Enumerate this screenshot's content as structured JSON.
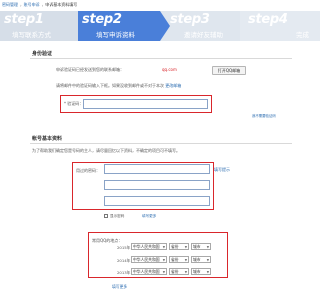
{
  "breadcrumb": {
    "items": [
      "密码管理",
      "账号申诉",
      "申诉基本资料填写"
    ],
    "separator": "›"
  },
  "steps": [
    {
      "label": "step1",
      "sub": "填写联系方式"
    },
    {
      "label": "step2",
      "sub": "填写申诉资料"
    },
    {
      "label": "step3",
      "sub": "邀请好友辅助"
    },
    {
      "label": "step4",
      "sub": "完成"
    }
  ],
  "verify": {
    "title": "身份验证",
    "email_notice_prefix": "申诉验证码已经发送到您的联系邮箱：",
    "email_masked": "qq.com",
    "open_mail_button": "打开QQ邮箱",
    "instruction": "请将邮件中的验证码输入下框。如果没收到邮件或不对于本次 ",
    "instruction_link": "更改邮箱",
    "code_label": "* 验证码：",
    "code_value": "",
    "side_note": "我不需要验证码"
  },
  "account": {
    "title": "帐号基本资料",
    "intro": "为了帮助我们确定您是号码的主人，请尽量回忆以下资料，不确定的项目可不填写。",
    "password_label": "用过的密码：",
    "password_hint": "填写提示",
    "passwords": [
      "",
      "",
      ""
    ],
    "show_password_label": "显示密码",
    "show_password_link": "填写更多",
    "locations_label": "常用QQ的地点：",
    "locations": [
      {
        "year": "2015年",
        "country": "中华人民共和国",
        "province": "省份",
        "city": "城市"
      },
      {
        "year": "2014年",
        "country": "中华人民共和国",
        "province": "省份",
        "city": "城市"
      },
      {
        "year": "2013年",
        "country": "中华人民共和国",
        "province": "省份",
        "city": "城市"
      }
    ],
    "more_link": "填写更多"
  },
  "colors": {
    "step_active": "#4a7fd9",
    "highlight": "#d9272c",
    "link": "#2b6cb0"
  }
}
